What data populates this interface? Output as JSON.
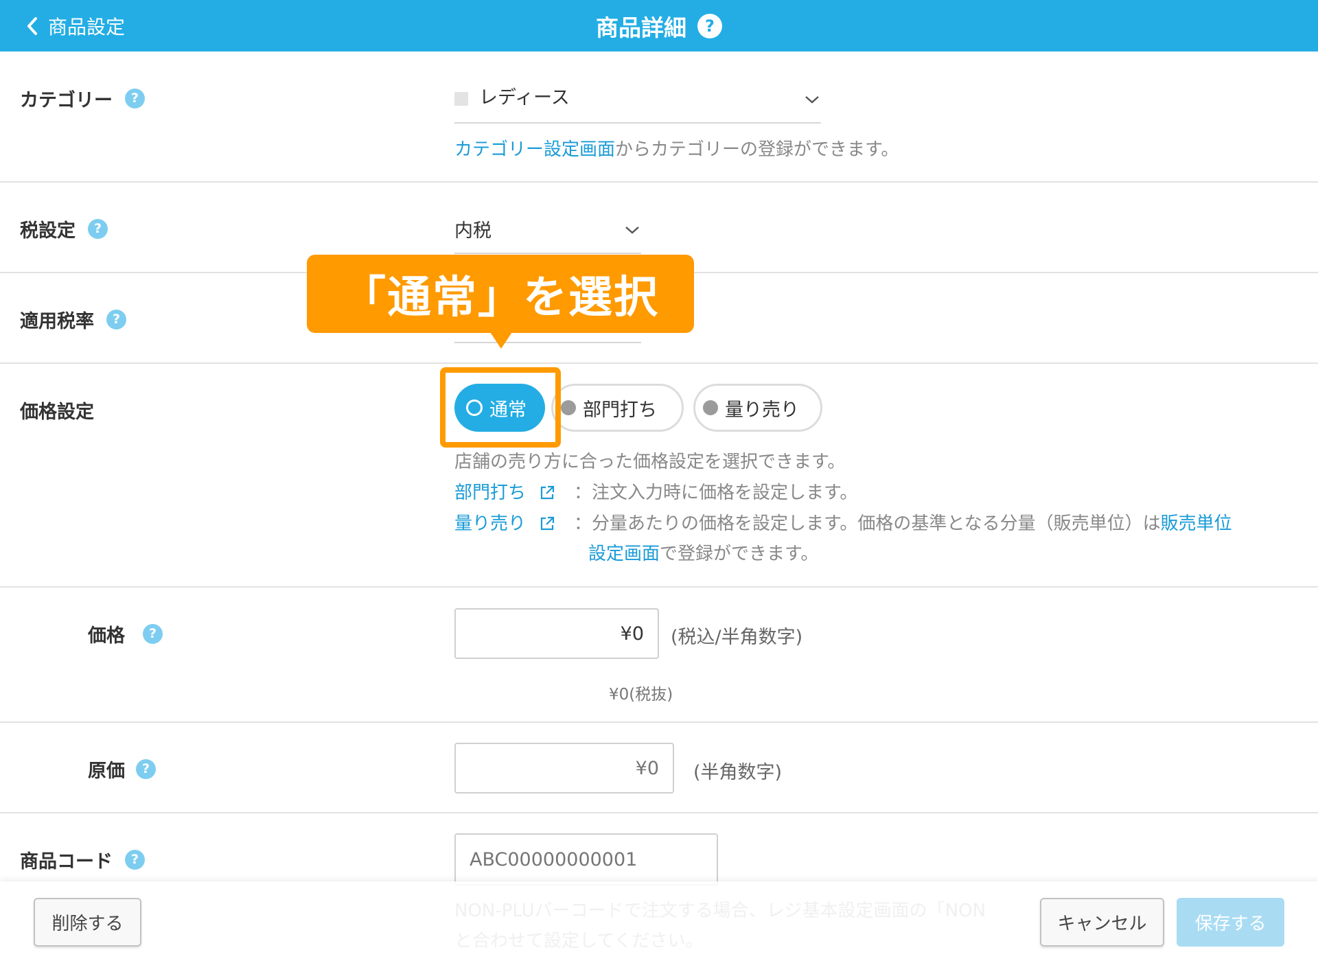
{
  "header": {
    "back_label": "商品設定",
    "title": "商品詳細",
    "help": "?"
  },
  "fields": {
    "category": {
      "label": "カテゴリー",
      "help": "?",
      "value": "レディース",
      "hint_link": "カテゴリー設定画面",
      "hint_text": "からカテゴリーの登録ができます。"
    },
    "tax": {
      "label": "税設定",
      "help": "?",
      "value": "内税"
    },
    "tax_rate": {
      "label": "適用税率",
      "help": "?"
    },
    "price_setting": {
      "label": "価格設定",
      "options": [
        "通常",
        "部門打ち",
        "量り売り"
      ],
      "selected": "通常",
      "hint": "店舗の売り方に合った価格設定を選択できます。",
      "dept_link": "部門打ち",
      "dept_text": "：注文入力時に価格を設定します。",
      "weight_link": "量り売り",
      "weight_text": "：分量あたりの価格を設定します。価格の基準となる分量（販売単位）は",
      "weight_link2a": "販売単位",
      "weight_link2b": "設定画面",
      "weight_text2": "で登録ができます。"
    },
    "price": {
      "label": "価格",
      "help": "?",
      "value": "¥0",
      "unit": "(税込/半角数字)",
      "tax_excluded": "¥0(税抜)"
    },
    "cost": {
      "label": "原価",
      "help": "?",
      "placeholder": "¥0",
      "unit": "(半角数字)"
    },
    "code": {
      "label": "商品コード",
      "help": "?",
      "placeholder": "ABC00000000001",
      "hint1a": "NON-PLUバーコードで注文する場合、",
      "hint1_link": "レジ基本設定画面",
      "hint1b": "の「NON",
      "hint2": "と合わせて設定してください。"
    }
  },
  "callout": {
    "text": "「通常」を選択"
  },
  "footer": {
    "delete": "削除する",
    "cancel": "キャンセル",
    "save": "保存する"
  },
  "colors": {
    "brand": "#23ade4",
    "link": "#1a9bd7",
    "callout": "#ff9a00"
  }
}
